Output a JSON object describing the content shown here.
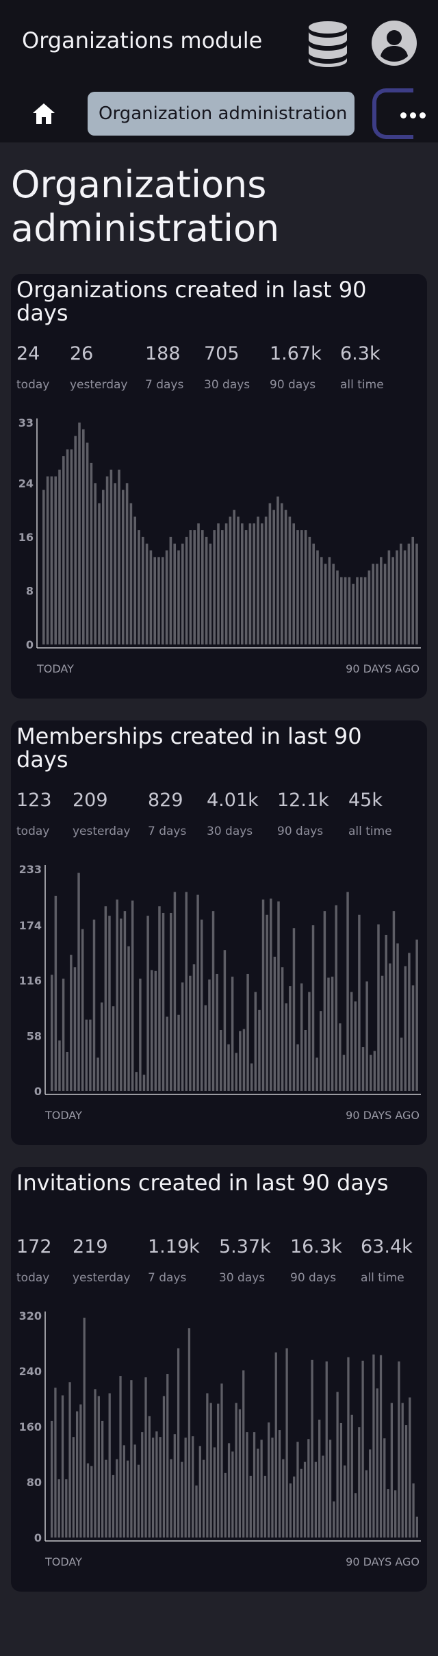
{
  "app": {
    "title": "Organizations module",
    "nav_tab_label": "Organization administration"
  },
  "icons": {
    "database": "database-icon",
    "user": "user-avatar-icon",
    "home": "home-icon",
    "more": "more-horizontal-icon"
  },
  "colors": {
    "background": "#212129",
    "header": "#121219",
    "card": "#11111b",
    "bar": "#5e5e66",
    "tab": "#a7b4c1",
    "tab_border": "#3d3d86"
  },
  "page": {
    "title": "Organizations administration"
  },
  "cards": [
    {
      "title": "Organizations created in last 90 days",
      "stats": [
        {
          "value": "24",
          "label": "today"
        },
        {
          "value": "26",
          "label": "yesterday"
        },
        {
          "value": "188",
          "label": "7 days"
        },
        {
          "value": "705",
          "label": "30 days"
        },
        {
          "value": "1.67k",
          "label": "90 days"
        },
        {
          "value": "6.3k",
          "label": "all time"
        }
      ],
      "x_left_label": "TODAY",
      "x_right_label": "90 DAYS AGO"
    },
    {
      "title": "Memberships created in last 90 days",
      "stats": [
        {
          "value": "123",
          "label": "today"
        },
        {
          "value": "209",
          "label": "yesterday"
        },
        {
          "value": "829",
          "label": "7 days"
        },
        {
          "value": "4.01k",
          "label": "30 days"
        },
        {
          "value": "12.1k",
          "label": "90 days"
        },
        {
          "value": "45k",
          "label": "all time"
        }
      ],
      "x_left_label": "TODAY",
      "x_right_label": "90 DAYS AGO"
    },
    {
      "title": "Invitations created in last 90 days",
      "stats": [
        {
          "value": "172",
          "label": "today"
        },
        {
          "value": "219",
          "label": "yesterday"
        },
        {
          "value": "1.19k",
          "label": "7 days"
        },
        {
          "value": "5.37k",
          "label": "30 days"
        },
        {
          "value": "16.3k",
          "label": "90 days"
        },
        {
          "value": "63.4k",
          "label": "all time"
        }
      ],
      "x_left_label": "TODAY",
      "x_right_label": "90 DAYS AGO"
    }
  ],
  "chart_data": [
    {
      "type": "bar",
      "title": "Organizations created in last 90 days",
      "x_labels": [
        "TODAY",
        "90 DAYS AGO"
      ],
      "ylim": [
        0,
        33
      ],
      "y_ticks": [
        0,
        8,
        16,
        24,
        33
      ],
      "values": [
        23,
        25,
        25,
        25,
        26,
        28,
        29,
        29,
        31,
        33,
        32,
        30,
        27,
        24,
        21,
        23,
        25,
        26,
        24,
        26,
        23,
        24,
        21,
        19,
        17,
        16,
        15,
        14,
        13,
        13,
        13,
        14,
        16,
        15,
        14,
        15,
        16,
        17,
        17,
        18,
        17,
        16,
        15,
        17,
        18,
        17,
        18,
        19,
        20,
        19,
        18,
        17,
        18,
        18,
        19,
        18,
        19,
        21,
        20,
        22,
        21,
        20,
        19,
        18,
        17,
        17,
        17,
        16,
        15,
        14,
        13,
        12,
        13,
        12,
        11,
        10,
        10,
        10,
        9,
        10,
        10,
        10,
        11,
        12,
        12,
        13,
        12,
        14,
        13,
        14,
        15,
        14,
        15,
        16,
        15
      ]
    },
    {
      "type": "bar",
      "title": "Memberships created in last 90 days",
      "x_labels": [
        "TODAY",
        "90 DAYS AGO"
      ],
      "ylim": [
        0,
        233
      ],
      "y_ticks": [
        0,
        58,
        116,
        174,
        233
      ],
      "values": [
        122,
        205,
        53,
        118,
        41,
        143,
        130,
        229,
        170,
        75,
        75,
        180,
        35,
        93,
        194,
        184,
        89,
        201,
        181,
        189,
        152,
        200,
        20,
        118,
        17,
        184,
        127,
        126,
        194,
        187,
        78,
        187,
        209,
        80,
        114,
        209,
        121,
        133,
        206,
        180,
        90,
        117,
        189,
        123,
        64,
        148,
        49,
        120,
        40,
        63,
        65,
        123,
        29,
        104,
        85,
        201,
        185,
        202,
        141,
        199,
        130,
        92,
        110,
        171,
        49,
        113,
        64,
        104,
        174,
        35,
        84,
        189,
        119,
        120,
        195,
        71,
        38,
        209,
        104,
        94,
        185,
        46,
        115,
        38,
        42,
        175,
        121,
        164,
        134,
        189,
        155,
        56,
        131,
        145,
        111,
        159
      ]
    },
    {
      "type": "bar",
      "title": "Invitations created in last 90 days",
      "x_labels": [
        "TODAY",
        "90 DAYS AGO"
      ],
      "ylim": [
        0,
        320
      ],
      "y_ticks": [
        0,
        80,
        160,
        240,
        320
      ],
      "values": [
        168,
        216,
        84,
        205,
        84,
        224,
        145,
        182,
        192,
        317,
        107,
        103,
        214,
        204,
        168,
        112,
        208,
        90,
        113,
        233,
        133,
        111,
        227,
        134,
        105,
        152,
        231,
        175,
        144,
        153,
        145,
        204,
        236,
        113,
        149,
        273,
        109,
        144,
        302,
        146,
        75,
        132,
        112,
        208,
        194,
        130,
        193,
        222,
        93,
        136,
        124,
        194,
        185,
        241,
        152,
        89,
        152,
        128,
        141,
        89,
        166,
        144,
        267,
        155,
        113,
        273,
        78,
        88,
        138,
        99,
        109,
        142,
        256,
        109,
        170,
        118,
        254,
        141,
        52,
        210,
        165,
        104,
        260,
        177,
        64,
        159,
        255,
        97,
        127,
        264,
        215,
        263,
        143,
        70,
        194,
        68,
        254,
        194,
        162,
        202,
        78,
        30
      ]
    }
  ]
}
